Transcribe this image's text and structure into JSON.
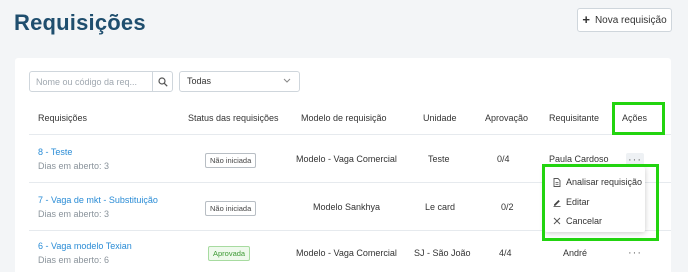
{
  "page": {
    "title": "Requisições"
  },
  "header": {
    "new_button_label": "Nova requisição"
  },
  "filters": {
    "search_placeholder": "Nome ou código da req...",
    "status_select_value": "Todas"
  },
  "table": {
    "columns": [
      "Requisições",
      "Status das requisições",
      "Modelo de requisição",
      "Unidade",
      "Aprovação",
      "Requisitante",
      "Ações"
    ],
    "rows": [
      {
        "title": "8 - Teste",
        "subtitle": "Dias em aberto: 3",
        "status": "Não iniciada",
        "model": "Modelo - Vaga Comercial",
        "unit": "Teste",
        "approval": "0/4",
        "requester": "Paula Cardoso"
      },
      {
        "title": "7 - Vaga de mkt - Substituição",
        "subtitle": "Dias em aberto: 3",
        "status": "Não iniciada",
        "model": "Modelo Sankhya",
        "unit": "Le card",
        "approval": "0/2",
        "requester": ""
      },
      {
        "title": "6 - Vaga modelo Texian",
        "subtitle": "Dias em aberto: 6",
        "status": "Aprovada",
        "model": "Modelo - Vaga Comercial",
        "unit": "SJ - São João",
        "approval": "4/4",
        "requester": "André"
      }
    ],
    "actions_glyph": "···"
  },
  "actions_menu": {
    "items": [
      "Analisar requisição",
      "Editar",
      "Cancelar"
    ]
  },
  "colors": {
    "title": "#1f4e6e",
    "link": "#2a8cd6",
    "highlight": "#22d40f",
    "approved_badge": "#3d9a35"
  }
}
